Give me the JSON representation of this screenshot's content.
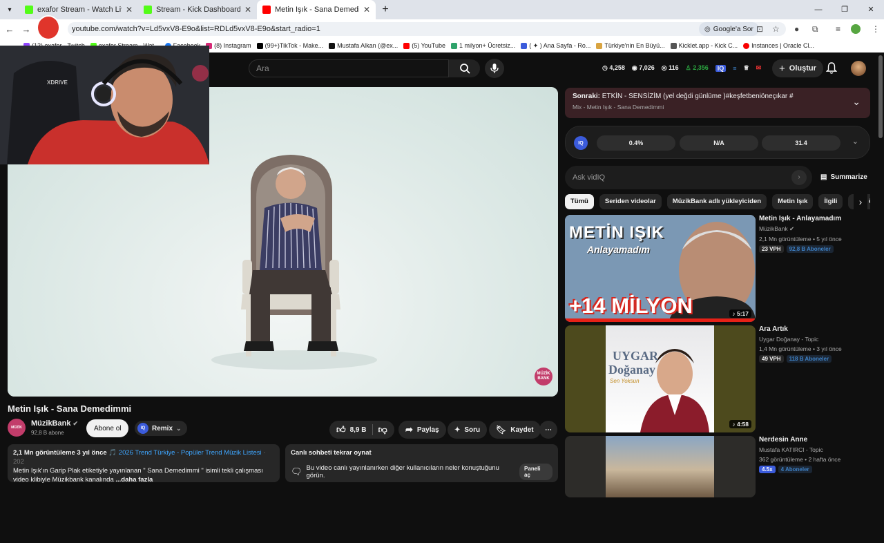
{
  "browser": {
    "tabs": [
      {
        "label": "exafor Stream - Watch Live on",
        "fav": "#53fc18"
      },
      {
        "label": "Stream - Kick Dashboard",
        "fav": "#53fc18"
      },
      {
        "label": "Metin Işık - Sana Demedimmi",
        "fav": "#ff0000"
      }
    ],
    "url": "youtube.com/watch?v=Ld5vxV8-E9o&list=RDLd5vxV8-E9o&start_radio=1",
    "google_sor": "Google'a Sor",
    "bookmarks": [
      "(12) exafor - Twitch",
      "exafor Stream - Wat...",
      "Facebook",
      "(8) Instagram",
      "(99+)TikTok - Make...",
      "Mustafa Alkan (@ex...",
      "(5) YouTube",
      "1 milyon+ Ücretsiz...",
      "( ✦ ) Ana Sayfa - Ro...",
      "Türkiye'nin En Büyü...",
      "Kicklet.app - Kick C...",
      "Instances | Oracle Cl..."
    ]
  },
  "youtube": {
    "search_placeholder": "Ara",
    "stats": {
      "clock": "4,258",
      "eye": "7,026",
      "live": "116",
      "users": "2,356"
    },
    "create_label": "Oluştur"
  },
  "video": {
    "title": "Metin Işık - Sana Demedimmi",
    "watermark": "MÜZİK BANK",
    "channel": "MüzikBank",
    "subs": "92,8 B abone",
    "subscribe_label": "Abone ol",
    "remix_label": "Remix",
    "likes": "8,9 B",
    "share_label": "Paylaş",
    "ask_label": "Soru",
    "save_label": "Kaydet",
    "desc_meta": "2,1 Mn görüntüleme  3 yıl önce",
    "desc_tag": "🎵 2026 Trend Türkiye - Popüler Trend Müzik Listesi",
    "desc_tag_fade": "· 202",
    "desc_line1": "Metin Işık'ın Garip Plak etiketiyle yayınlanan  \" Sana Demedimmi \"  isimli tekli çalışması",
    "desc_line2": "video klibiyle Müzikbank kanalında",
    "desc_more": "...daha fazla",
    "chat_title": "Canlı sohbeti tekrar oynat",
    "chat_text": "Bu video canlı yayınlanırken diğer kullanıcıların neler konuştuğunu görün.",
    "chat_btn": "Paneli aç"
  },
  "sidebar": {
    "next_prefix": "Sonraki:",
    "next_title": "ETKİN - SENSİZİM (yel değdi günlüme )#keşfetbeniöneçıkar #",
    "next_mix": "Mix - Metin Işık - Sana Demedimmi",
    "iq_values": [
      "0.4%",
      "N/A",
      "31.4"
    ],
    "ask_placeholder": "Ask vidIQ",
    "summarize_label": "Summarize",
    "chips": [
      "Tümü",
      "Seriden videolar",
      "MüzikBank adlı yükleyiciden",
      "Metin Işık",
      "İlgili",
      "Size ö"
    ],
    "cards": [
      {
        "title": "Metin Işık - Anlayamadım",
        "channel": "MüzikBank",
        "meta": "2,1 Mn görüntüleme • 5 yıl önce",
        "vph": "23 VPH",
        "subs": "92,8 B Aboneler",
        "dur": "5:17",
        "thumb_top": "METİN IŞIK",
        "thumb_sub": "Anlayamadım",
        "thumb_big": "+14 MİLYON"
      },
      {
        "title": "Ara Artık",
        "channel": "Uygar Doğanay - Topic",
        "meta": "1,4 Mn görüntüleme • 3 yıl önce",
        "vph": "49 VPH",
        "subs": "118 B Aboneler",
        "dur": "4:58",
        "thumb_top": "UYGAR",
        "thumb_sub": "Doğanay",
        "thumb_big": "Sen Yoksun"
      },
      {
        "title": "Nerdesin Anne",
        "channel": "Mustafa KATIRCI - Topic",
        "meta": "362 görüntüleme • 2 hafta önce",
        "vph": "4.5x",
        "subs": "4 Aboneler"
      }
    ]
  }
}
